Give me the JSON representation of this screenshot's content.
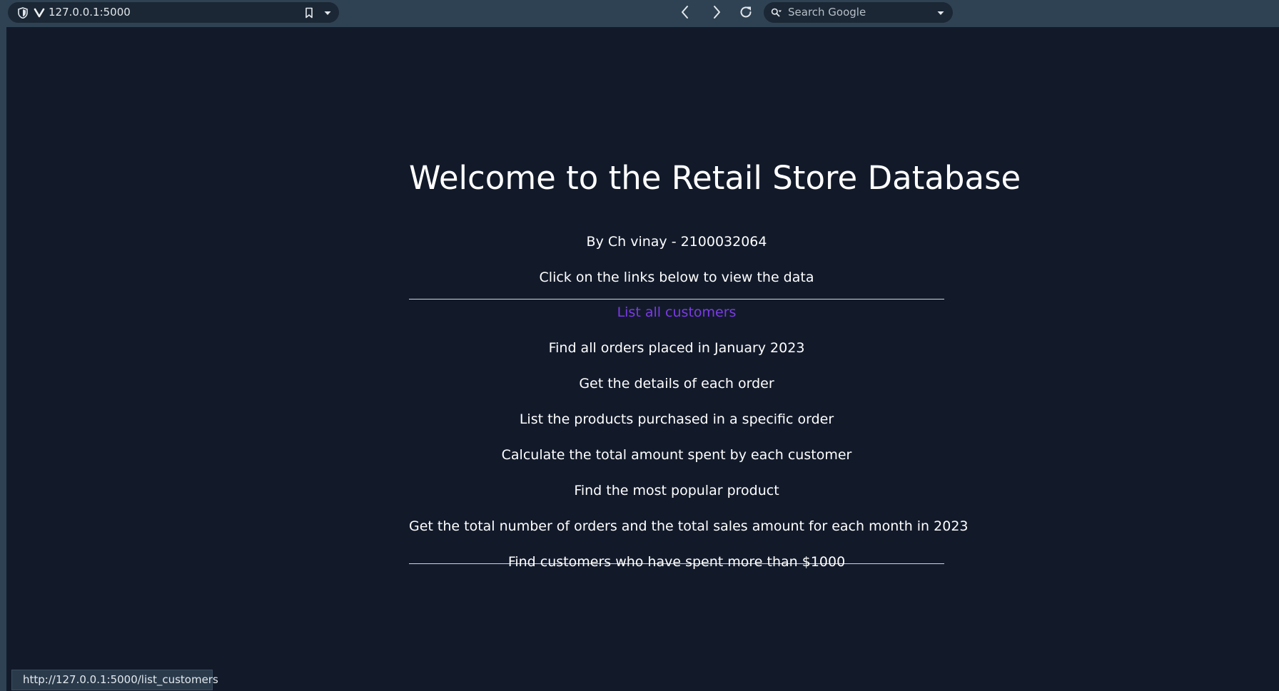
{
  "browser": {
    "url": "127.0.0.1:5000",
    "search_placeholder": "Search Google",
    "status_url": "http://127.0.0.1:5000/list_customers"
  },
  "page": {
    "title": "Welcome to the Retail Store Database",
    "subtitle": "By Ch vinay - 2100032064",
    "instruction": "Click on the links below to view the data",
    "links": [
      {
        "label": "List all customers",
        "visited": true
      },
      {
        "label": "Find all orders placed in January 2023",
        "visited": false
      },
      {
        "label": "Get the details of each order",
        "visited": false
      },
      {
        "label": "List the products purchased in a specific order",
        "visited": false
      },
      {
        "label": "Calculate the total amount spent by each customer",
        "visited": false
      },
      {
        "label": "Find the most popular product",
        "visited": false
      },
      {
        "label": "Get the total number of orders and the total sales amount for each month in 2023",
        "visited": false
      },
      {
        "label": "Find customers who have spent more than $1000",
        "visited": false
      }
    ]
  },
  "colors": {
    "background": "#121a2a",
    "toolbar": "#2f4253",
    "text": "#ffffff",
    "visited_link": "#7c3ae8"
  }
}
